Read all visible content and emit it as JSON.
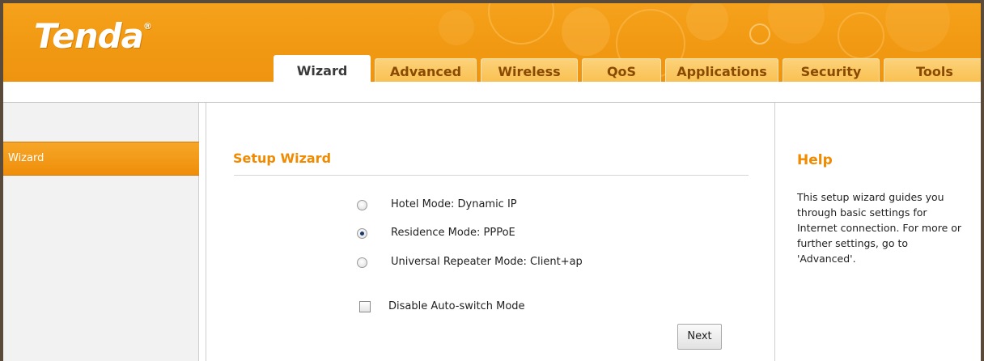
{
  "header": {
    "logo_text": "Tenda",
    "logo_mark": "®",
    "tabs": [
      {
        "label": "Wizard",
        "active": true
      },
      {
        "label": "Advanced",
        "active": false
      },
      {
        "label": "Wireless",
        "active": false
      },
      {
        "label": "QoS",
        "active": false
      },
      {
        "label": "Applications",
        "active": false
      },
      {
        "label": "Security",
        "active": false
      },
      {
        "label": "Tools",
        "active": false
      }
    ]
  },
  "sidebar": {
    "items": [
      {
        "label": "Wizard",
        "active": true
      }
    ]
  },
  "main": {
    "title": "Setup Wizard",
    "options": [
      {
        "label": "Hotel Mode:  Dynamic IP",
        "checked": false
      },
      {
        "label": "Residence Mode:  PPPoE",
        "checked": true
      },
      {
        "label": "Universal Repeater Mode:   Client+ap",
        "checked": false
      }
    ],
    "disable_auto_switch": {
      "label": "Disable Auto-switch Mode",
      "checked": false
    },
    "next_label": "Next"
  },
  "help": {
    "title": "Help",
    "text": "This setup wizard guides you through basic settings for Internet connection. For more or further settings, go to 'Advanced'."
  },
  "colors": {
    "brand_orange": "#f29a14",
    "title_orange": "#f08a00",
    "frame_border": "#5a4a3a"
  }
}
